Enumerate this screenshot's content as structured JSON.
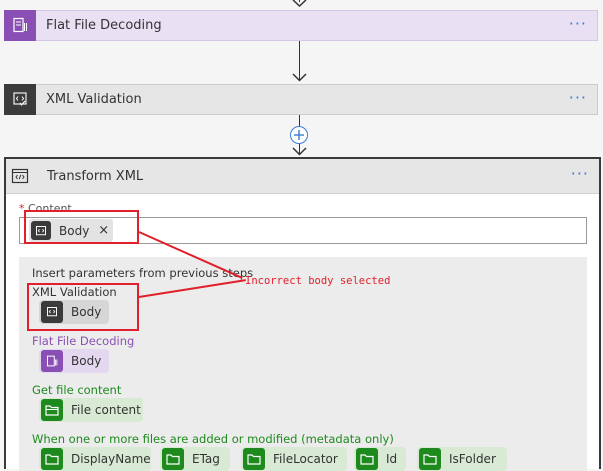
{
  "steps": {
    "flat_file": {
      "title": "Flat File Decoding",
      "menu": "···"
    },
    "xml_validation": {
      "title": "XML Validation",
      "menu": "···"
    },
    "transform": {
      "title": "Transform XML",
      "menu": "···"
    }
  },
  "content_field": {
    "required_mark": "*",
    "label": "Content",
    "token_label": "Body",
    "remove_glyph": "×"
  },
  "picker": {
    "heading": "Insert parameters from previous steps",
    "groups": [
      {
        "name": "XML Validation",
        "tokens": [
          "Body"
        ]
      },
      {
        "name": "Flat File Decoding",
        "tokens": [
          "Body"
        ]
      },
      {
        "name": "Get file content",
        "tokens": [
          "File content"
        ]
      },
      {
        "name": "When one or more files are added or modified (metadata only)",
        "tokens": [
          "DisplayName",
          "ETag",
          "FileLocator",
          "Id",
          "IsFolder"
        ]
      }
    ]
  },
  "annotation": {
    "text": "Incorrect body selected"
  },
  "colors": {
    "flat_file_bg": "#e9e1f3",
    "flat_file_icon": "#8a4fb4",
    "xml_bg": "#e6e6e6",
    "xml_icon": "#3b3b3b",
    "accent_link": "#3b7bd4",
    "group_green": "#1e8a1e",
    "group_purple": "#8a4fb4",
    "annotation_red": "#e0202a"
  }
}
